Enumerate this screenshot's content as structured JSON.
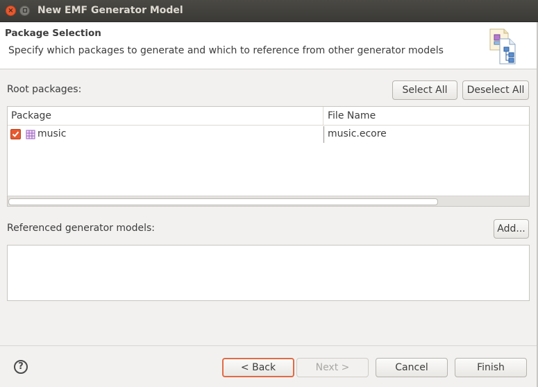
{
  "window": {
    "title": "New EMF Generator Model"
  },
  "header": {
    "title": "Package Selection",
    "description": "Specify which packages to generate and which to reference from other generator models",
    "icon": "generator-model-wizard-icon"
  },
  "root_packages": {
    "label": "Root packages:",
    "select_all": "Select All",
    "deselect_all": "Deselect All",
    "columns": [
      "Package",
      "File Name"
    ],
    "rows": [
      {
        "checked": true,
        "icon": "package-icon",
        "package": "music",
        "file": "music.ecore"
      }
    ]
  },
  "referenced": {
    "label": "Referenced generator models:",
    "add": "Add..."
  },
  "footer": {
    "help_glyph": "?",
    "back": "< Back",
    "next": "Next >",
    "cancel": "Cancel",
    "finish": "Finish"
  },
  "colors": {
    "accent": "#e9582e",
    "titlebar": "#3b3a36"
  }
}
